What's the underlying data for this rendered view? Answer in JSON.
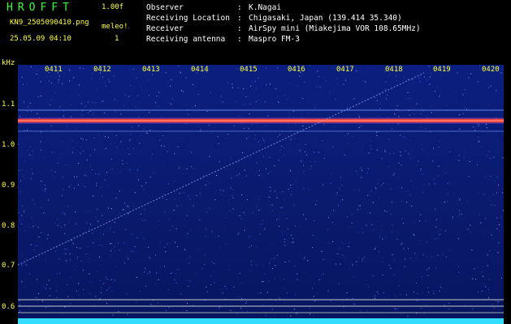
{
  "header": {
    "logo": "HROFFT",
    "version": "1.00f",
    "filename": "KN9_2505090410.png",
    "meleo_label": "meleo!",
    "datetime": "25.05.09 04:10",
    "count": "1"
  },
  "info": [
    {
      "key": "Observer",
      "value": "K.Nagai"
    },
    {
      "key": "Receiving Location",
      "value": "Chigasaki, Japan (139.414 35.340)"
    },
    {
      "key": "Receiver",
      "value": "AirSpy mini (Miakejima VOR 108.65MHz)"
    },
    {
      "key": "Receiving antenna",
      "value": "Maspro FM-3"
    }
  ],
  "axis": {
    "y_unit": "kHz",
    "y_ticks": [
      "1.1",
      "1.0",
      "0.9",
      "0.8",
      "0.7",
      "0.6"
    ],
    "x_ticks": [
      "0411",
      "0412",
      "0413",
      "0414",
      "0415",
      "0416",
      "0417",
      "0418",
      "0419",
      "0420"
    ]
  },
  "colors": {
    "background": "#000000",
    "plot_bg": "#0a1a6e",
    "text_yellow": "#ffff33",
    "logo_green": "#33ff33",
    "signal_red": "#ff3030",
    "cyan": "#33ddff"
  }
}
